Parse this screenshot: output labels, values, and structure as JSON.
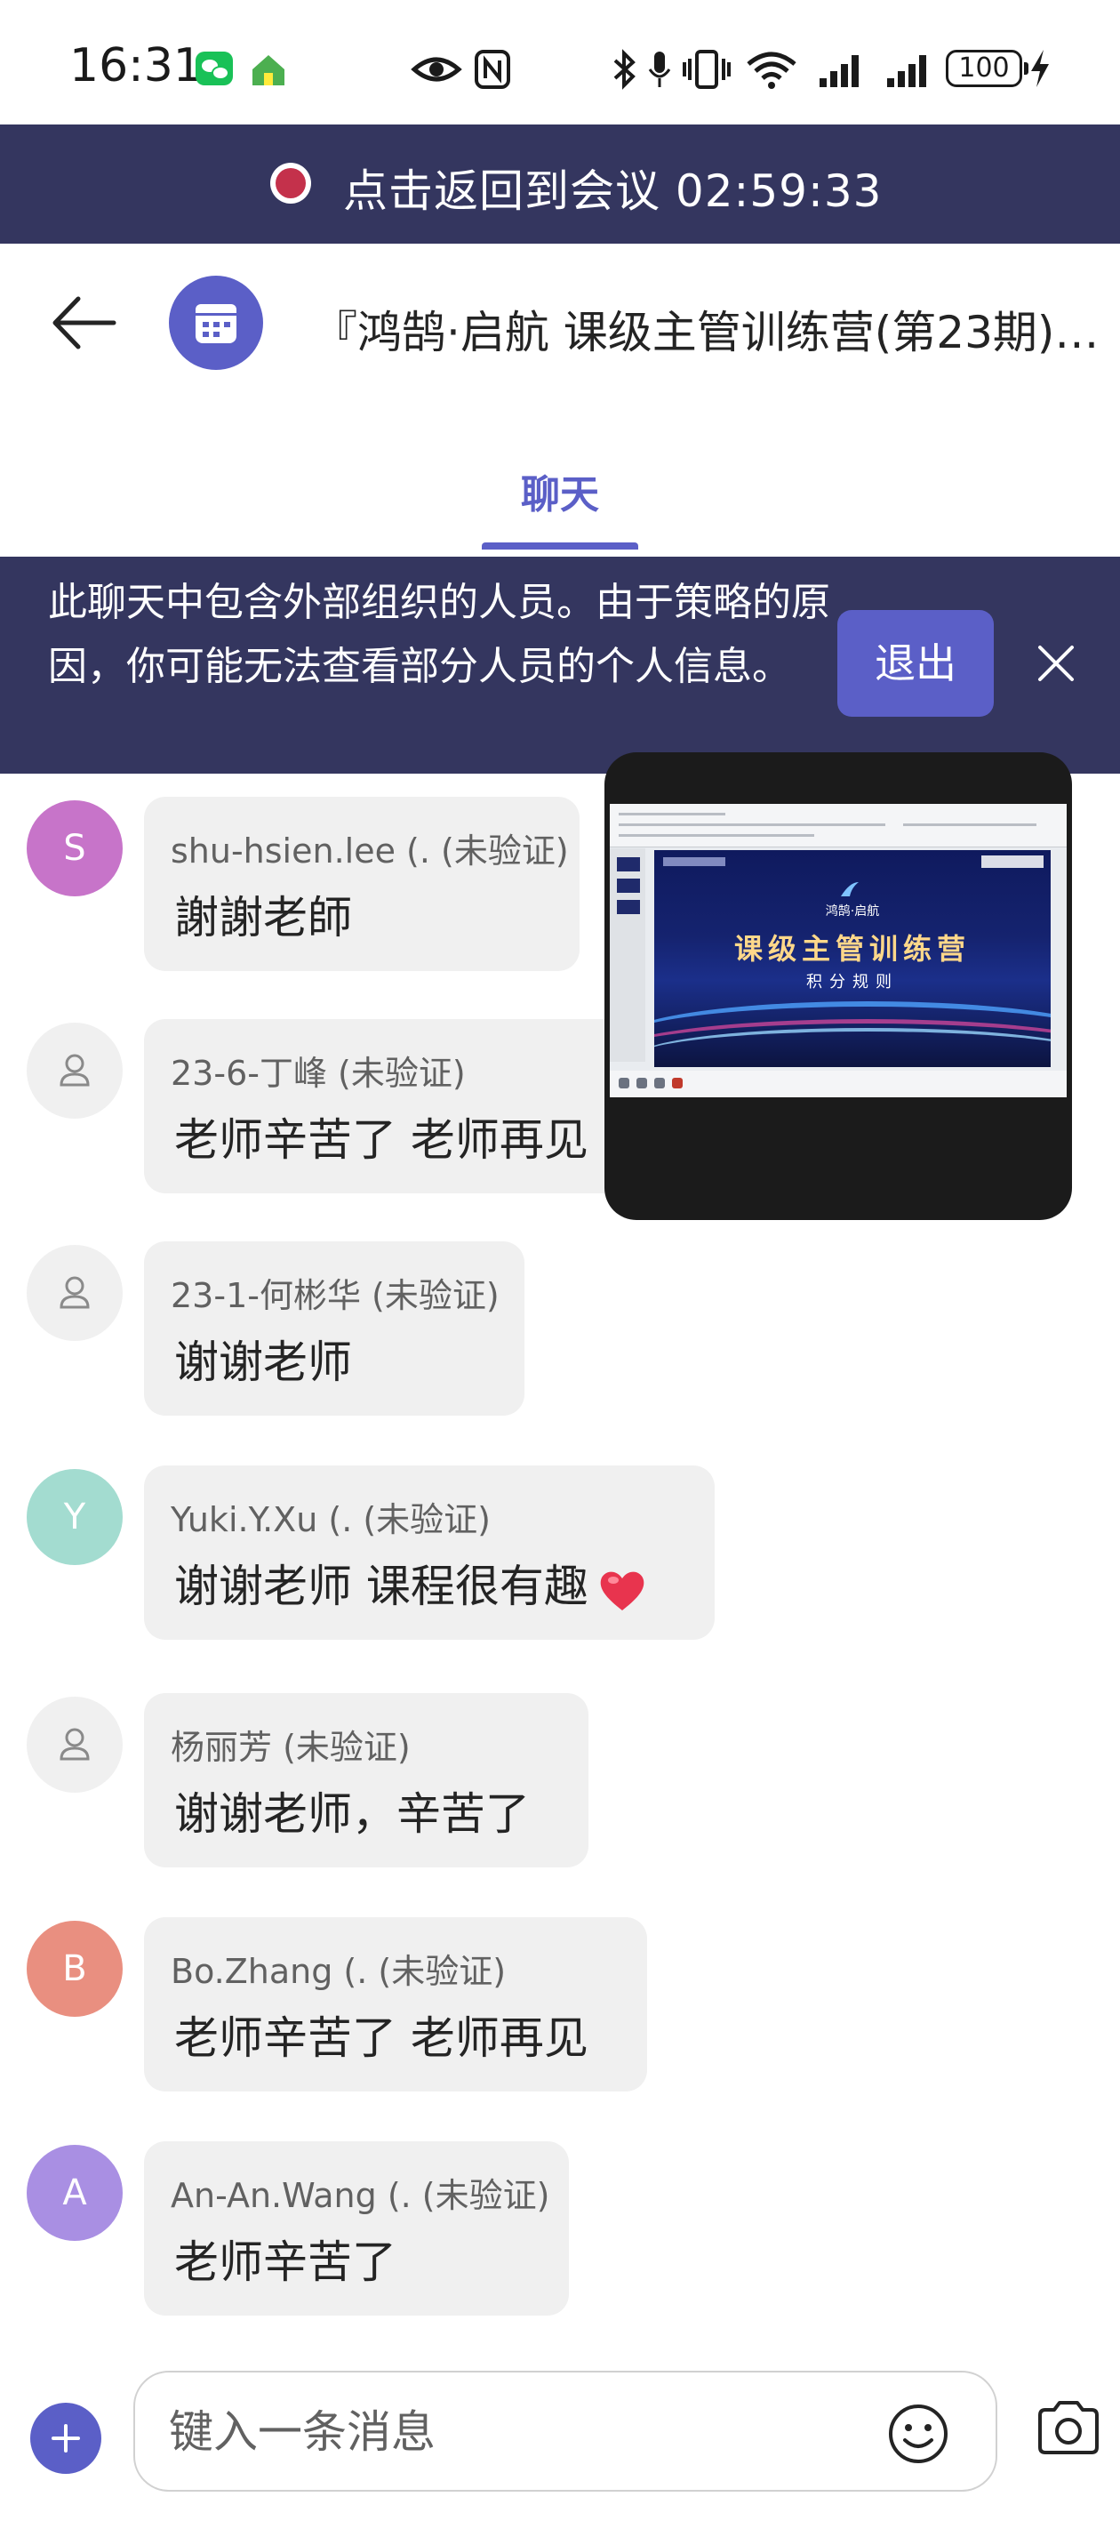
{
  "status_bar": {
    "time": "16:31",
    "battery": "100",
    "icons": [
      "wechat-icon",
      "home-icon",
      "eye-icon",
      "nfc-icon",
      "bluetooth-icon",
      "mic-icon",
      "vibrate-icon",
      "wifi-icon",
      "signal-icon",
      "signal-icon",
      "battery-icon",
      "charging-icon"
    ]
  },
  "meeting_bar": {
    "text": "点击返回到会议 02:59:33",
    "dot_color": "#c4314b"
  },
  "header": {
    "title": "『鸿鹄·启航 课级主管训练营(第23期)…"
  },
  "tabs": [
    {
      "label": "聊天",
      "active": true
    }
  ],
  "notice": {
    "text": "此聊天中包含外部组织的人员。由于策略的原因，你可能无法查看部分人员的个人信息。",
    "exit_label": "退出"
  },
  "messages": [
    {
      "avatar_letter": "S",
      "avatar_color": "#c774c9",
      "sender": "shu-hsien.lee (. (未验证)",
      "text": "謝謝老師"
    },
    {
      "avatar_letter": "",
      "avatar_color": "#f0f0f0",
      "sender": "23-6-丁峰 (未验证)",
      "text": "老师辛苦了 老师再见"
    },
    {
      "avatar_letter": "",
      "avatar_color": "#f0f0f0",
      "sender": "23-1-何彬华 (未验证)",
      "text": "谢谢老师"
    },
    {
      "avatar_letter": "Y",
      "avatar_color": "#a3dcd0",
      "sender": "Yuki.Y.Xu (. (未验证)",
      "text": "谢谢老师 课程很有趣"
    },
    {
      "avatar_letter": "",
      "avatar_color": "#f0f0f0",
      "sender": "杨丽芳 (未验证)",
      "text": "谢谢老师，辛苦了"
    },
    {
      "avatar_letter": "B",
      "avatar_color": "#e98f80",
      "sender": "Bo.Zhang (. (未验证)",
      "text": "老师辛苦了 老师再见"
    },
    {
      "avatar_letter": "A",
      "avatar_color": "#a98fe3",
      "sender": "An-An.Wang (. (未验证)",
      "text": "老师辛苦了"
    }
  ],
  "video": {
    "slide_top": "鸿鹄·启航",
    "slide_title": "课级主管训练营",
    "slide_subtitle": "积分规则"
  },
  "composer": {
    "placeholder": "键入一条消息"
  },
  "theme": {
    "accent": "#5b5fc7",
    "banner": "#34365f"
  }
}
